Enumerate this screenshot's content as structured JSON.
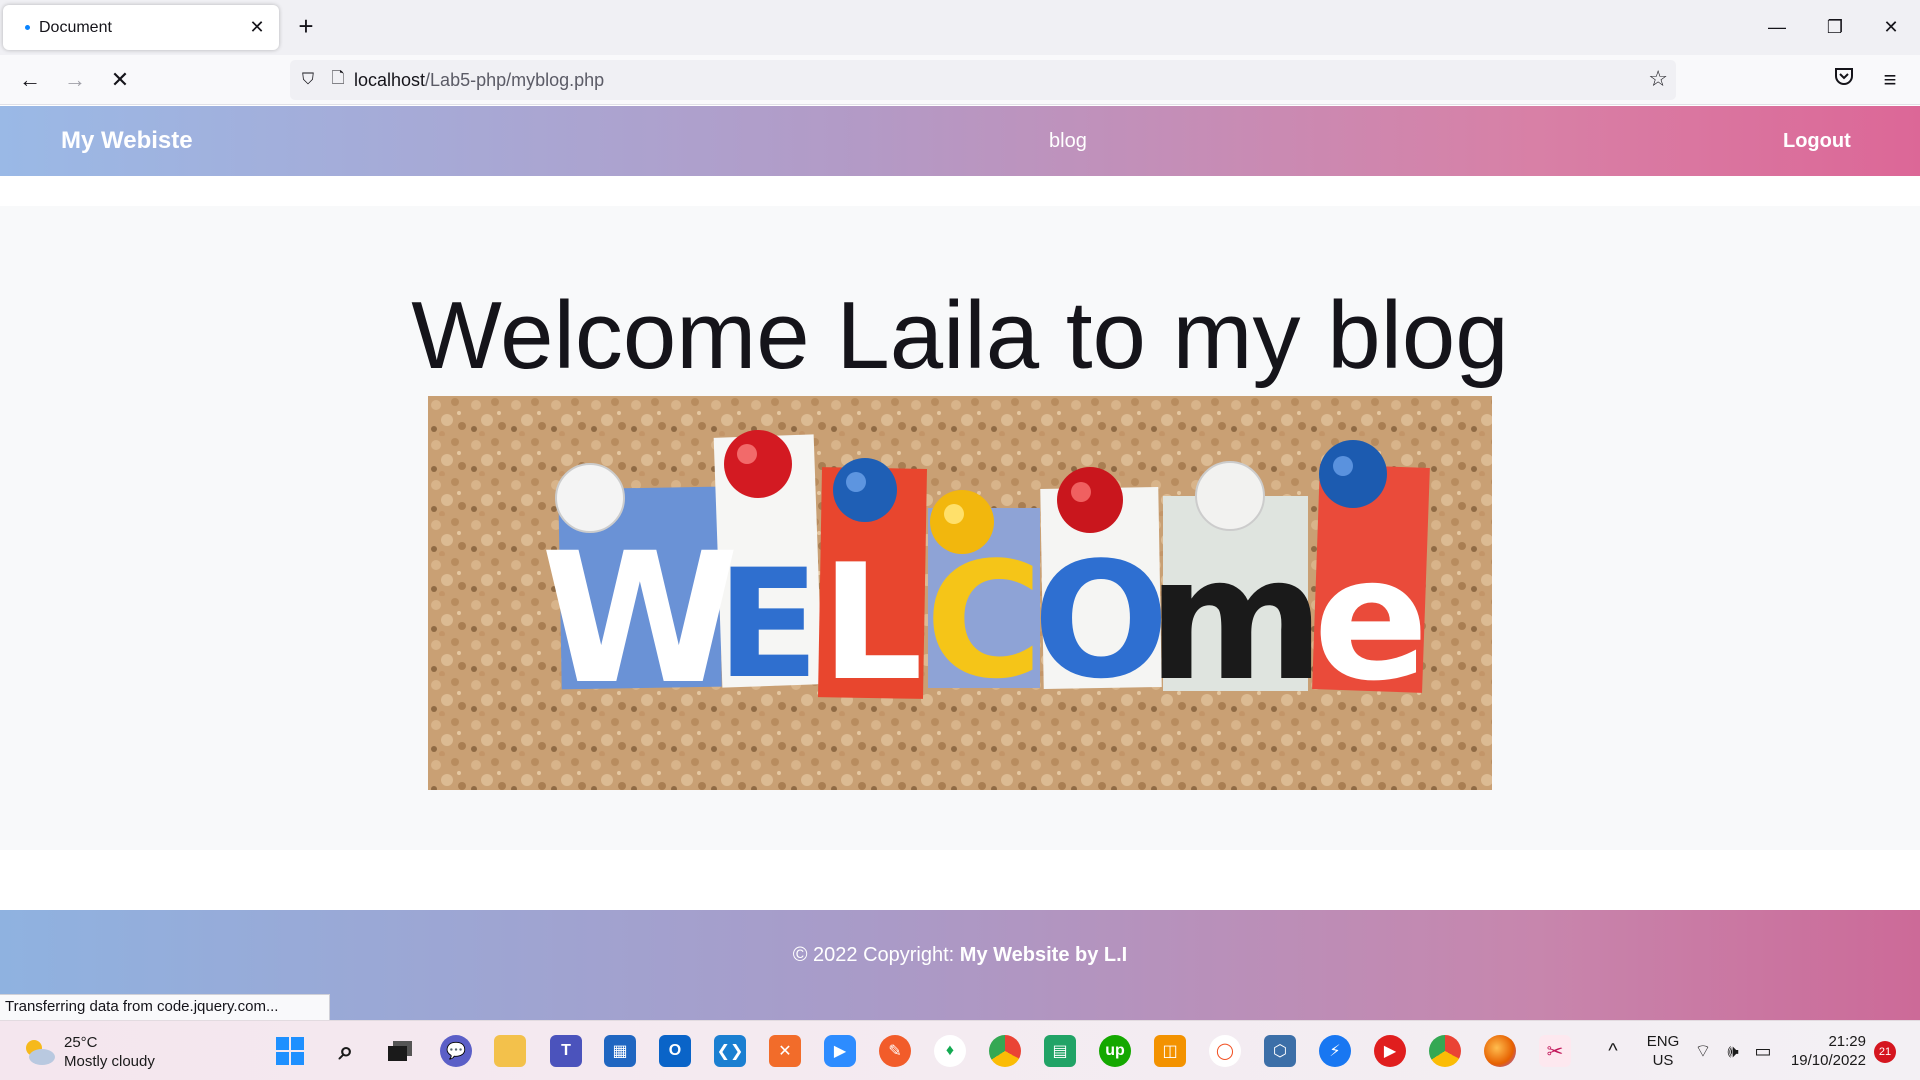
{
  "browser": {
    "tab_title": "Document",
    "url_host": "localhost",
    "url_path": "/Lab5-php/myblog.php"
  },
  "site": {
    "brand": "My Webiste",
    "nav_blog": "blog",
    "nav_logout": "Logout",
    "heading": "Welcome Laila to my blog",
    "hero_letters": [
      "W",
      "E",
      "L",
      "C",
      "O",
      "m",
      "e"
    ],
    "footer_prefix": "© 2022 Copyright: ",
    "footer_bold": "My Website by L.I"
  },
  "status_text": "Transferring data from code.jquery.com...",
  "taskbar": {
    "temperature": "25°C",
    "weather": "Mostly cloudy",
    "lang_1": "ENG",
    "lang_2": "US",
    "time": "21:29",
    "date": "19/10/2022",
    "notifications": "21"
  }
}
